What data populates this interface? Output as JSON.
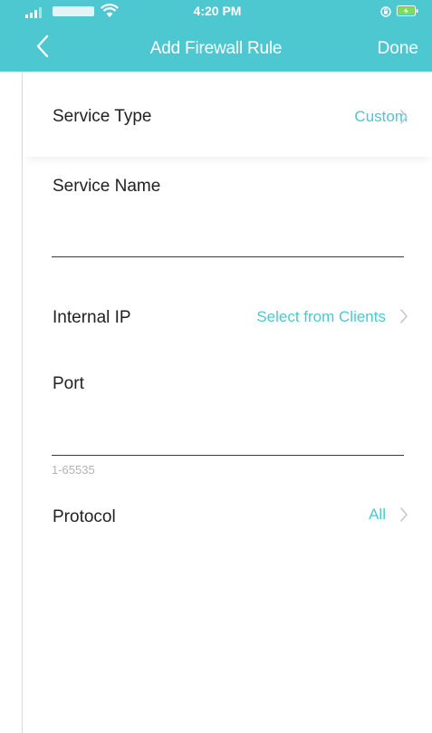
{
  "status_bar": {
    "time": "4:20 PM"
  },
  "nav": {
    "title": "Add Firewall Rule",
    "done_label": "Done",
    "back_icon": "chevron-left-icon"
  },
  "form": {
    "service_type": {
      "label": "Service Type",
      "value": "Custom"
    },
    "service_name": {
      "label": "Service Name",
      "value": ""
    },
    "internal_ip": {
      "label": "Internal IP",
      "value": "Select from Clients"
    },
    "port": {
      "label": "Port",
      "value": "",
      "hint": "1-65535"
    },
    "protocol": {
      "label": "Protocol",
      "value": "All"
    }
  },
  "colors": {
    "accent": "#4dc8d0",
    "text": "#222222",
    "hint": "#b3b3b3",
    "chevron": "#c7c7cc"
  }
}
